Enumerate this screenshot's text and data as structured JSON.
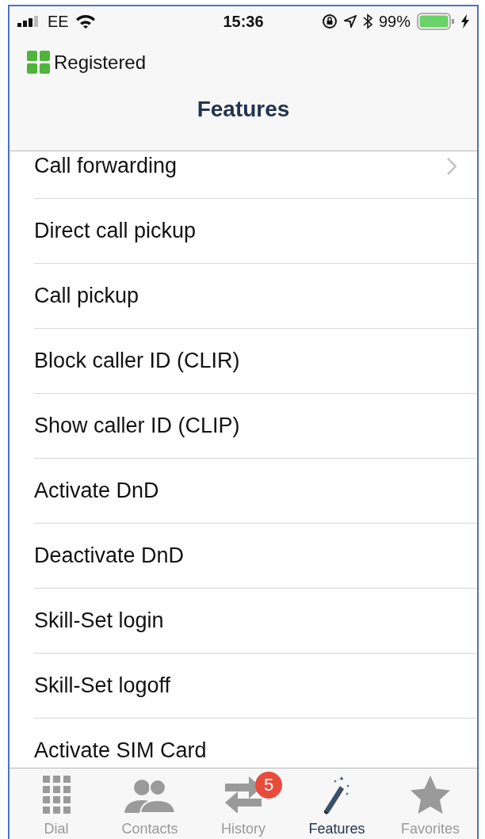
{
  "status_bar": {
    "carrier": "EE",
    "time": "15:36",
    "battery": "99%"
  },
  "registration": {
    "status": "Registered"
  },
  "title": "Features",
  "features": [
    {
      "label": "Call forwarding",
      "has_chevron": true
    },
    {
      "label": "Direct call pickup",
      "has_chevron": false
    },
    {
      "label": "Call pickup",
      "has_chevron": false
    },
    {
      "label": "Block caller ID (CLIR)",
      "has_chevron": false
    },
    {
      "label": "Show caller ID (CLIP)",
      "has_chevron": false
    },
    {
      "label": "Activate DnD",
      "has_chevron": false
    },
    {
      "label": "Deactivate DnD",
      "has_chevron": false
    },
    {
      "label": "Skill-Set login",
      "has_chevron": false
    },
    {
      "label": "Skill-Set logoff",
      "has_chevron": false
    },
    {
      "label": "Activate SIM Card",
      "has_chevron": false
    }
  ],
  "tabs": [
    {
      "kind": "dial",
      "label": "Dial",
      "selected": false
    },
    {
      "kind": "contacts",
      "label": "Contacts",
      "selected": false
    },
    {
      "kind": "history",
      "label": "History",
      "selected": false,
      "badge": "5"
    },
    {
      "kind": "features",
      "label": "Features",
      "selected": true
    },
    {
      "kind": "favorites",
      "label": "Favorites",
      "selected": false
    }
  ]
}
